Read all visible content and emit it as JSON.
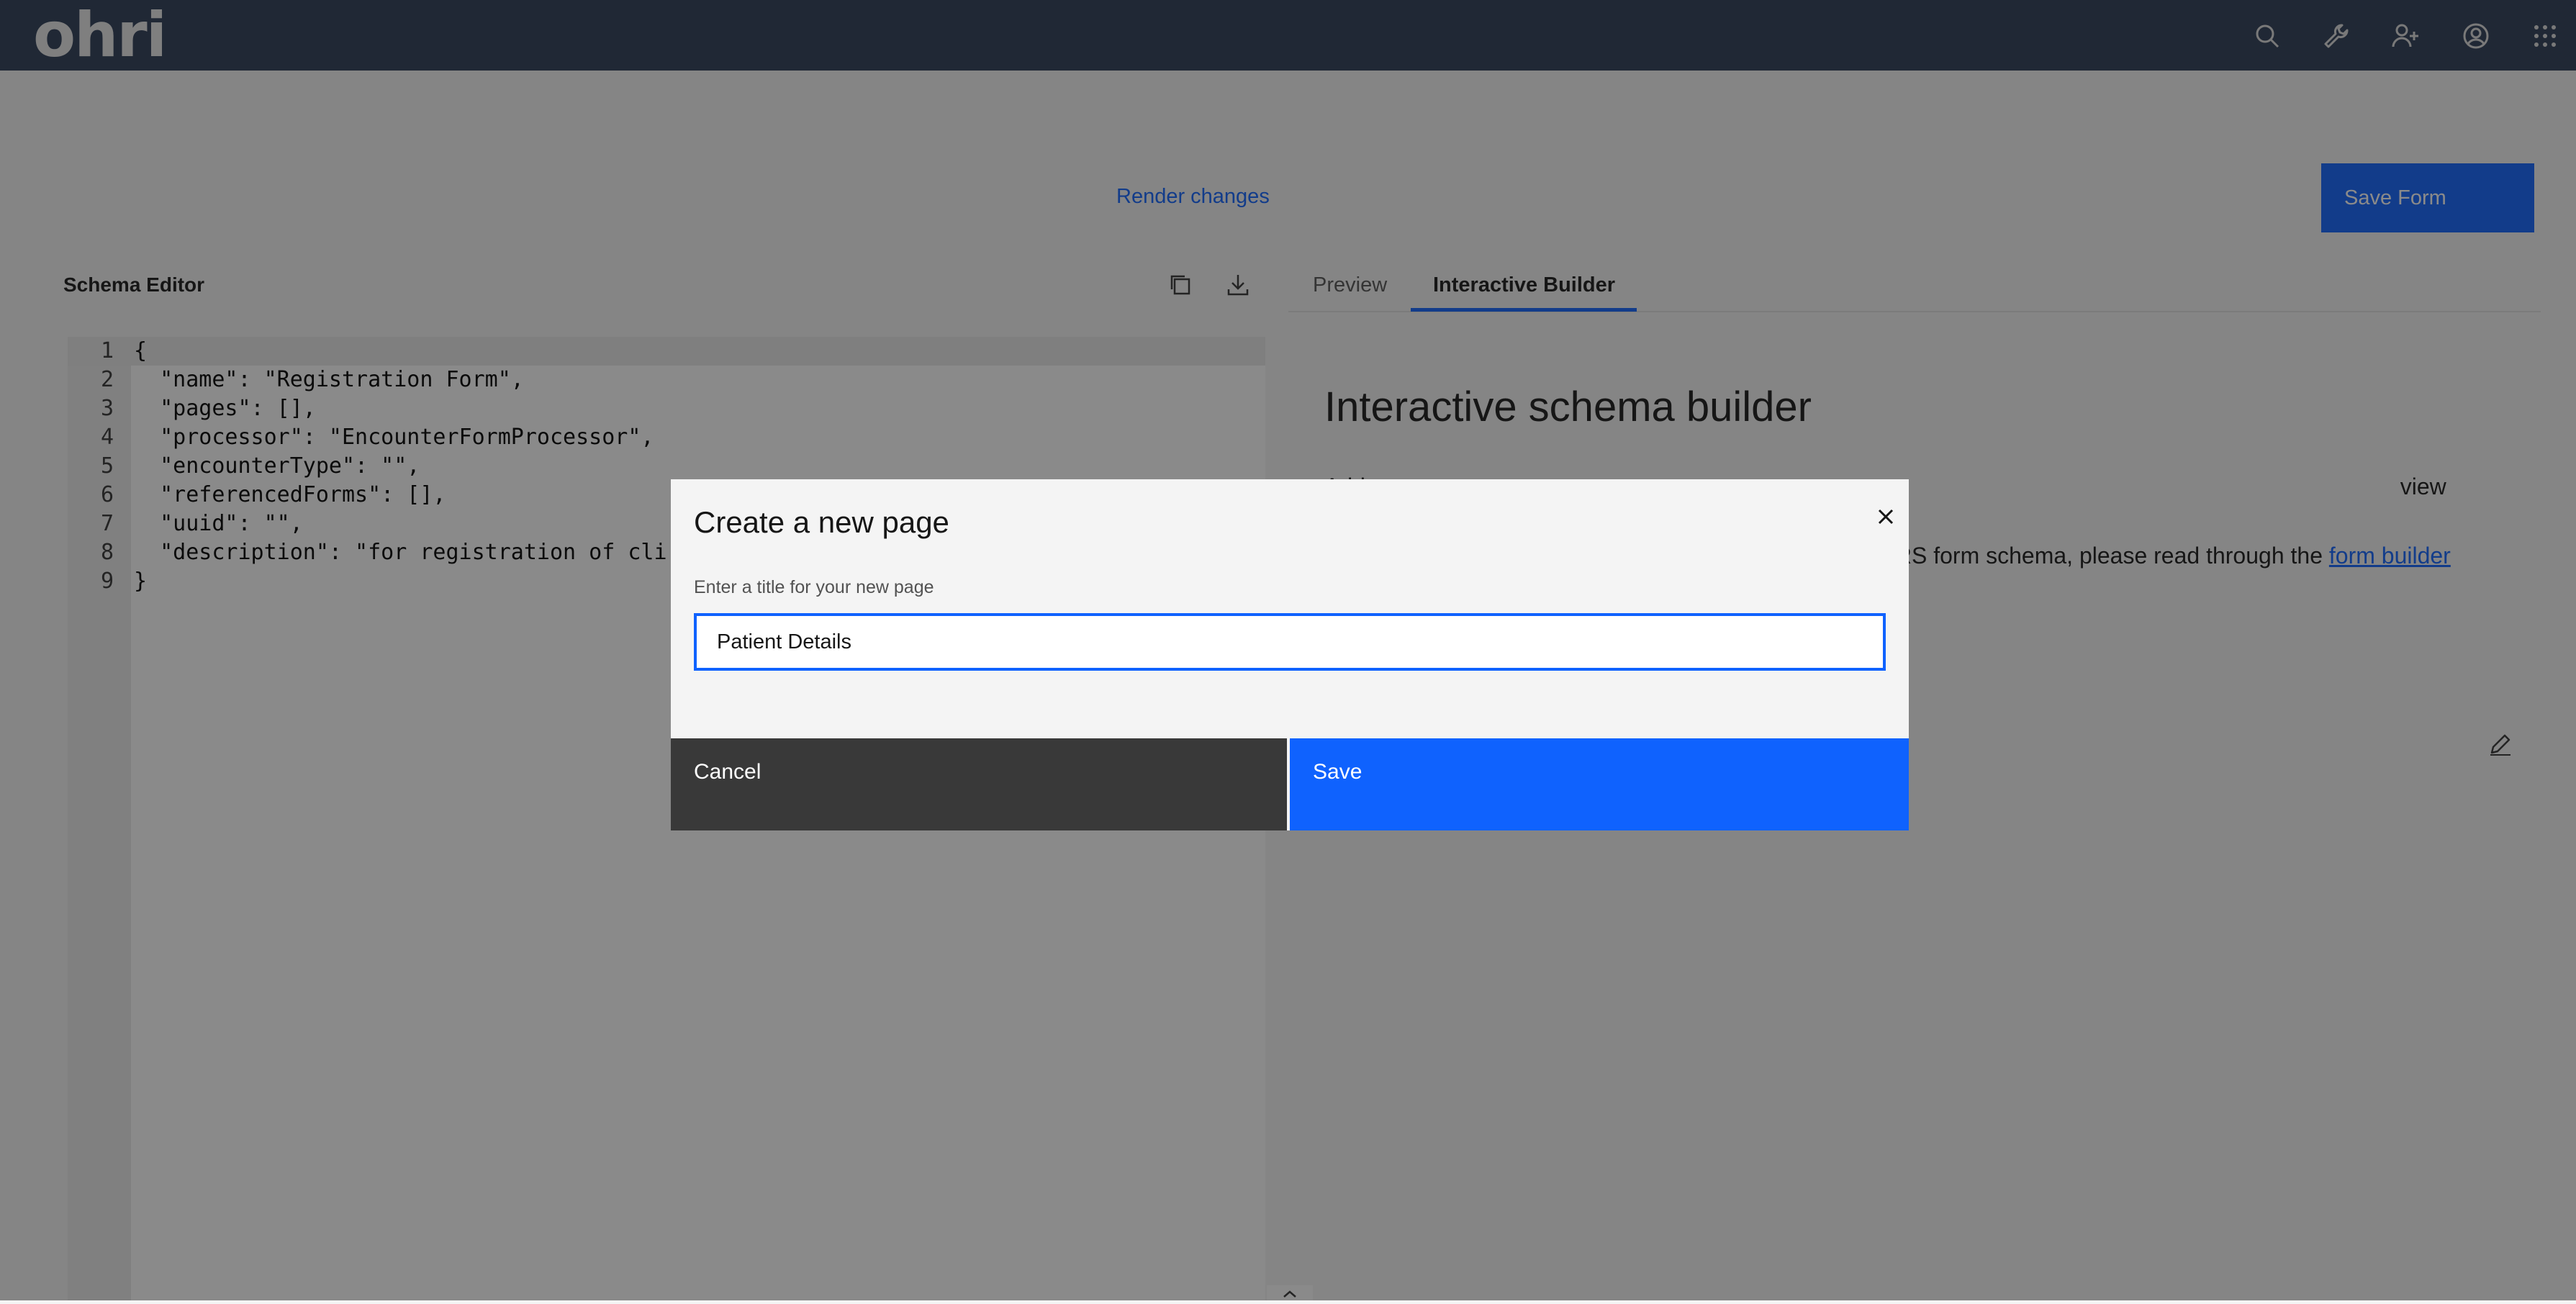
{
  "app": {
    "logo": "ohri"
  },
  "topnav": {
    "icons": [
      "search-icon",
      "wrench-icon",
      "add-user-icon",
      "user-avatar-icon",
      "app-switcher-icon"
    ]
  },
  "toolbar": {
    "render_changes": "Render changes",
    "save_form": "Save Form"
  },
  "schema_editor": {
    "title": "Schema Editor",
    "line_numbers": [
      "1",
      "2",
      "3",
      "4",
      "5",
      "6",
      "7",
      "8",
      "9"
    ],
    "lines": [
      "{",
      "  \"name\": \"Registration Form\",",
      "  \"pages\": [],",
      "  \"processor\": \"EncounterFormProcessor\",",
      "  \"encounterType\": \"\",",
      "  \"referencedForms\": [],",
      "  \"uuid\": \"\",",
      "  \"description\": \"for registration of cli",
      "}"
    ]
  },
  "tabs": {
    "preview": "Preview",
    "builder": "Interactive Builder"
  },
  "builder": {
    "heading": "Interactive schema builder",
    "desc_part1": "Add",
    "desc_part2": "view tab automatically updates as you build your form.",
    "desc_part3": "RS form schema, please read through the",
    "desc_link": "form builder"
  },
  "modal": {
    "title": "Create a new page",
    "label": "Enter a title for your new page",
    "input_value": "Patient Details",
    "cancel": "Cancel",
    "save": "Save"
  },
  "colors": {
    "topbar": "#2b3a55",
    "primary": "#0f62fe",
    "secondary_button": "#393939"
  }
}
